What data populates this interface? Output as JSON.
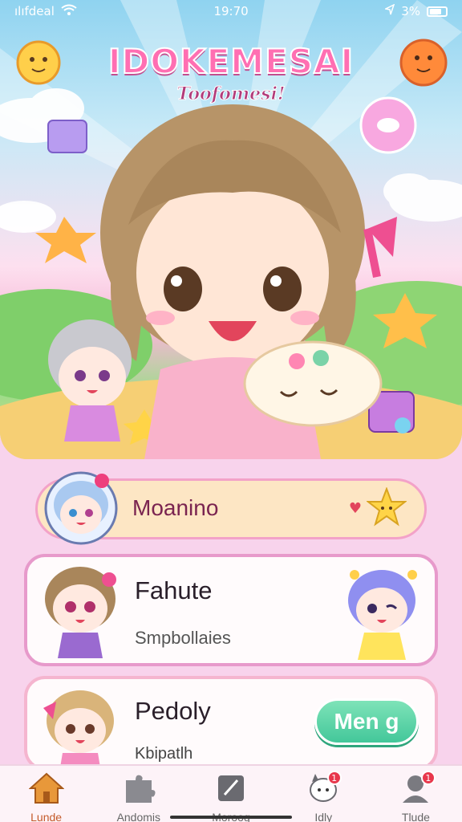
{
  "status_bar": {
    "carrier": "ılıfdeal",
    "time": "19:70",
    "battery": "3%"
  },
  "app": {
    "title": "IDOKEMESAI",
    "subtitle": "Toofomesi!"
  },
  "cards": [
    {
      "title": "Moanino"
    },
    {
      "title": "Fahute",
      "subtitle": "Smpbollaies"
    },
    {
      "title": "Pedoly",
      "subtitle": "Kbipatlh",
      "button_label": "Men g"
    }
  ],
  "bottom_nav": [
    {
      "label": "Lunde",
      "icon": "home-icon",
      "active": true
    },
    {
      "label": "Andomis",
      "icon": "puzzle-icon",
      "active": false
    },
    {
      "label": "Moroog",
      "icon": "pencil-icon",
      "active": false
    },
    {
      "label": "Idly",
      "icon": "cat-chat-icon",
      "active": false,
      "badge": "1"
    },
    {
      "label": "Tlude",
      "icon": "friends-icon",
      "active": false,
      "badge": "1"
    }
  ],
  "colors": {
    "accent_pink": "#ff6fb2",
    "menu_green": "#43c79a",
    "background": "#f8d3ec"
  }
}
